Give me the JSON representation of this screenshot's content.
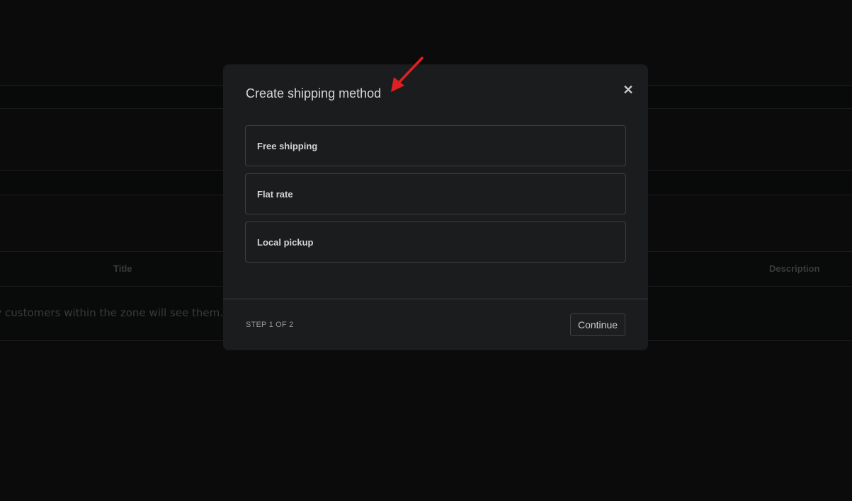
{
  "background": {
    "table": {
      "columns": [
        "Title",
        "Description"
      ],
      "empty_message": "You can add multiple shipping methods within this zone. Only customers within the zone will see them."
    }
  },
  "modal": {
    "title": "Create shipping method",
    "close_icon": "close-icon",
    "options": [
      {
        "label": "Free shipping"
      },
      {
        "label": "Flat rate"
      },
      {
        "label": "Local pickup"
      }
    ],
    "step_label": "STEP 1 OF 2",
    "continue_label": "Continue"
  },
  "annotation": {
    "type": "arrow",
    "color": "#e02020"
  }
}
